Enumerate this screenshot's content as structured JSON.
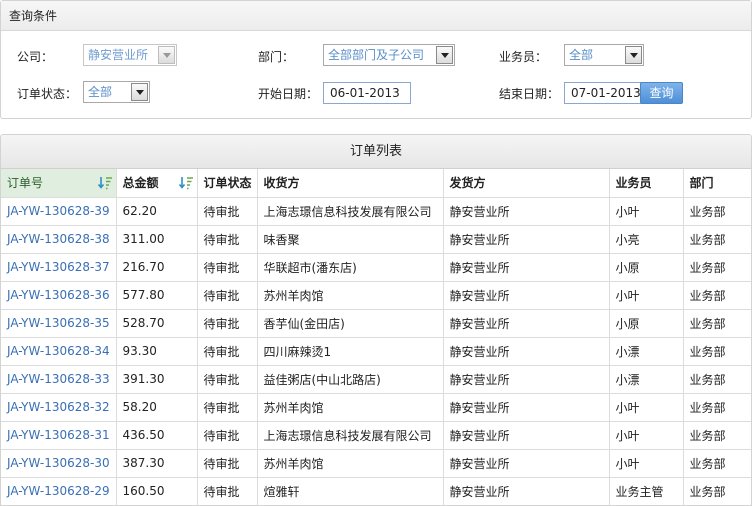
{
  "query": {
    "header": "查询条件",
    "company_label": "公司：",
    "company_value": "静安营业所",
    "department_label": "部门：",
    "department_value": "全部部门及子公司",
    "salesman_label": "业务员：",
    "salesman_value": "全部",
    "status_label": "订单状态：",
    "status_value": "全部",
    "start_label": "开始日期：",
    "start_value": "06-01-2013",
    "end_label": "结束日期：",
    "end_value": "07-01-2013",
    "search_button": "查询"
  },
  "orders": {
    "title": "订单列表",
    "columns": [
      "订单号",
      "总金额",
      "订单状态",
      "收货方",
      "发货方",
      "业务员",
      "部门"
    ],
    "rows": [
      [
        "JA-YW-130628-39",
        "62.20",
        "待审批",
        "上海志璟信息科技发展有限公司",
        "静安营业所",
        "小叶",
        "业务部"
      ],
      [
        "JA-YW-130628-38",
        "311.00",
        "待审批",
        "味香聚",
        "静安营业所",
        "小亮",
        "业务部"
      ],
      [
        "JA-YW-130628-37",
        "216.70",
        "待审批",
        "华联超市(潘东店)",
        "静安营业所",
        "小原",
        "业务部"
      ],
      [
        "JA-YW-130628-36",
        "577.80",
        "待审批",
        "苏州羊肉馆",
        "静安营业所",
        "小叶",
        "业务部"
      ],
      [
        "JA-YW-130628-35",
        "528.70",
        "待审批",
        "香芋仙(金田店)",
        "静安营业所",
        "小原",
        "业务部"
      ],
      [
        "JA-YW-130628-34",
        "93.30",
        "待审批",
        "四川麻辣烫1",
        "静安营业所",
        "小漂",
        "业务部"
      ],
      [
        "JA-YW-130628-33",
        "391.30",
        "待审批",
        "益佳粥店(中山北路店)",
        "静安营业所",
        "小漂",
        "业务部"
      ],
      [
        "JA-YW-130628-32",
        "58.20",
        "待审批",
        "苏州羊肉馆",
        "静安营业所",
        "小叶",
        "业务部"
      ],
      [
        "JA-YW-130628-31",
        "436.50",
        "待审批",
        "上海志璟信息科技发展有限公司",
        "静安营业所",
        "小叶",
        "业务部"
      ],
      [
        "JA-YW-130628-30",
        "387.30",
        "待审批",
        "苏州羊肉馆",
        "静安营业所",
        "小叶",
        "业务部"
      ],
      [
        "JA-YW-130628-29",
        "160.50",
        "待审批",
        "煊雅轩",
        "静安营业所",
        "业务主管",
        "业务部"
      ]
    ]
  },
  "colors": {
    "link": "#3a6fb5",
    "sorted_header_bg": "#dfeedf",
    "button_bg": "#4e8fd7"
  }
}
